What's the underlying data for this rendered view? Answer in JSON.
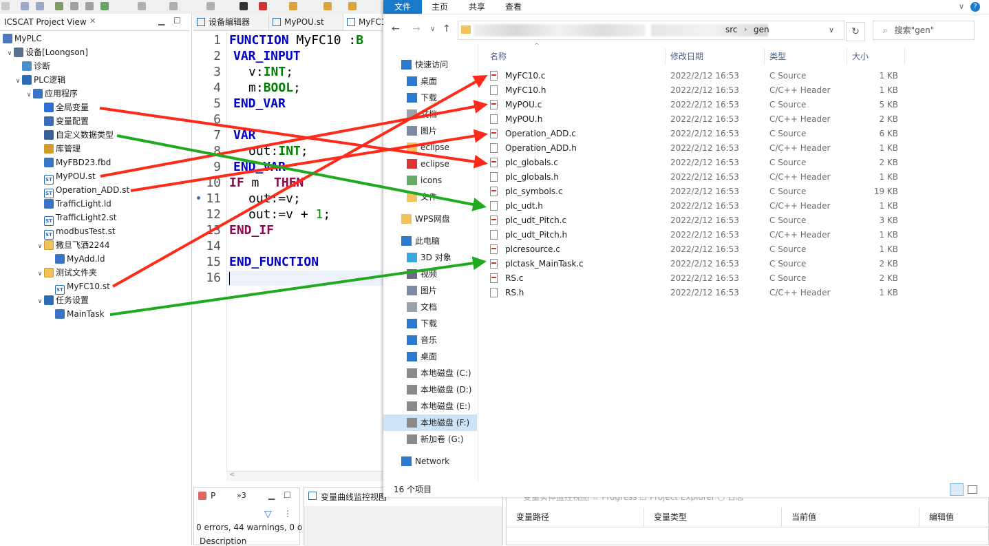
{
  "ide": {
    "project_view": {
      "title": "ICSCAT Project View",
      "tree": [
        {
          "label": "MyPLC",
          "icon": "project-icon"
        },
        {
          "label": "设备[Loongson]",
          "icon": "device-icon"
        },
        {
          "label": "诊断",
          "icon": "diagnose-icon"
        },
        {
          "label": "PLC逻辑",
          "icon": "gear-icon"
        },
        {
          "label": "应用程序",
          "icon": "application-icon"
        },
        {
          "label": "全局变量",
          "icon": "globe-icon"
        },
        {
          "label": "变量配置",
          "icon": "config-icon"
        },
        {
          "label": "自定义数据类型",
          "icon": "datatype-icon"
        },
        {
          "label": "库管理",
          "icon": "library-icon"
        },
        {
          "label": "MyFBD23.fbd",
          "icon": "fbd-icon"
        },
        {
          "label": "MyPOU.st",
          "icon": "st-icon"
        },
        {
          "label": "Operation_ADD.st",
          "icon": "st-icon"
        },
        {
          "label": "TrafficLight.ld",
          "icon": "ld-icon"
        },
        {
          "label": "TrafficLight2.st",
          "icon": "st-icon"
        },
        {
          "label": "modbusTest.st",
          "icon": "st-icon"
        },
        {
          "label": "撒旦飞洒2244",
          "icon": "folder-icon"
        },
        {
          "label": "MyAdd.ld",
          "icon": "ld-icon"
        },
        {
          "label": "测试文件夹",
          "icon": "folder-icon"
        },
        {
          "label": "MyFC10.st",
          "icon": "st-icon"
        },
        {
          "label": "任务设置",
          "icon": "task-settings-icon"
        },
        {
          "label": "MainTask",
          "icon": "task-icon"
        }
      ]
    },
    "editor_tabs": [
      "设备编辑器",
      "MyPOU.st",
      "MyFC1"
    ],
    "code": {
      "lines": [
        "1",
        "2",
        "3",
        "4",
        "5",
        "6",
        "7",
        "8",
        "9",
        "10",
        "11",
        "12",
        "13",
        "14",
        "15",
        "16"
      ],
      "l1_kw": "FUNCTION",
      "l1_name": " MyFC10 :",
      "l1_type": "B",
      "l2": "VAR_INPUT",
      "l3_a": "v:",
      "l3_t": "INT",
      "l3_b": ";",
      "l4_a": "m:",
      "l4_t": "BOOL",
      "l4_b": ";",
      "l5": "END_VAR",
      "l7": "VAR",
      "l8_a": "out:",
      "l8_t": "INT",
      "l8_b": ";",
      "l9": "END_VAR",
      "l10_kw": "IF",
      "l10_m": " m  ",
      "l10_then": "THEN",
      "l11": "out:=v;",
      "l12_a": "out:=v + ",
      "l12_n": "1",
      "l12_b": ";",
      "l13": "END_IF",
      "l15": "END_FUNCTION"
    },
    "problems": {
      "tab1": "P",
      "tab2": "»3",
      "summary": "0 errors, 44 warnings, 0 o",
      "col": "Description"
    },
    "monitor_tab": "变量曲线监控视图",
    "var_table": {
      "tabs_faded": "变量实体监控视图  ☆  Progress  ☐ Project Explorer  ○ 日志",
      "headers": [
        "变量路径",
        "变量类型",
        "当前值",
        "编辑值"
      ]
    }
  },
  "explorer": {
    "ribbon": [
      "文件",
      "主页",
      "共享",
      "查看"
    ],
    "breadcrumb": [
      "src",
      "gen"
    ],
    "search_placeholder": "搜索\"gen\"",
    "nav": [
      {
        "label": "快速访问",
        "icon": "star-icon"
      },
      {
        "label": "桌面",
        "icon": "desktop-icon"
      },
      {
        "label": "下载",
        "icon": "download-icon"
      },
      {
        "label": "文档",
        "icon": "document-icon"
      },
      {
        "label": "图片",
        "icon": "picture-icon"
      },
      {
        "label": "eclipse",
        "icon": "folder-icon"
      },
      {
        "label": "eclipse",
        "icon": "eclipse-icon"
      },
      {
        "label": "icons",
        "icon": "icons-icon"
      },
      {
        "label": "文件",
        "icon": "folder-icon"
      },
      {
        "label": "WPS网盘",
        "icon": "cloud-folder-icon"
      },
      {
        "label": "此电脑",
        "icon": "computer-icon"
      },
      {
        "label": "3D 对象",
        "icon": "3d-icon"
      },
      {
        "label": "视频",
        "icon": "video-icon"
      },
      {
        "label": "图片",
        "icon": "picture-icon"
      },
      {
        "label": "文档",
        "icon": "document-icon"
      },
      {
        "label": "下载",
        "icon": "download-icon"
      },
      {
        "label": "音乐",
        "icon": "music-icon"
      },
      {
        "label": "桌面",
        "icon": "desktop-icon"
      },
      {
        "label": "本地磁盘 (C:)",
        "icon": "drive-icon"
      },
      {
        "label": "本地磁盘 (D:)",
        "icon": "drive-icon"
      },
      {
        "label": "本地磁盘 (E:)",
        "icon": "drive-icon"
      },
      {
        "label": "本地磁盘 (F:)",
        "icon": "drive-icon"
      },
      {
        "label": "新加卷 (G:)",
        "icon": "drive-icon"
      },
      {
        "label": "Network",
        "icon": "network-icon"
      }
    ],
    "columns": [
      "名称",
      "修改日期",
      "类型",
      "大小"
    ],
    "files": [
      {
        "name": "MyFC10.c",
        "date": "2022/2/12 16:53",
        "type": "C Source",
        "size": "1 KB"
      },
      {
        "name": "MyFC10.h",
        "date": "2022/2/12 16:53",
        "type": "C/C++ Header",
        "size": "1 KB"
      },
      {
        "name": "MyPOU.c",
        "date": "2022/2/12 16:53",
        "type": "C Source",
        "size": "5 KB"
      },
      {
        "name": "MyPOU.h",
        "date": "2022/2/12 16:53",
        "type": "C/C++ Header",
        "size": "2 KB"
      },
      {
        "name": "Operation_ADD.c",
        "date": "2022/2/12 16:53",
        "type": "C Source",
        "size": "6 KB"
      },
      {
        "name": "Operation_ADD.h",
        "date": "2022/2/12 16:53",
        "type": "C/C++ Header",
        "size": "1 KB"
      },
      {
        "name": "plc_globals.c",
        "date": "2022/2/12 16:53",
        "type": "C Source",
        "size": "2 KB"
      },
      {
        "name": "plc_globals.h",
        "date": "2022/2/12 16:53",
        "type": "C/C++ Header",
        "size": "1 KB"
      },
      {
        "name": "plc_symbols.c",
        "date": "2022/2/12 16:53",
        "type": "C Source",
        "size": "19 KB"
      },
      {
        "name": "plc_udt.h",
        "date": "2022/2/12 16:53",
        "type": "C/C++ Header",
        "size": "1 KB"
      },
      {
        "name": "plc_udt_Pitch.c",
        "date": "2022/2/12 16:53",
        "type": "C Source",
        "size": "3 KB"
      },
      {
        "name": "plc_udt_Pitch.h",
        "date": "2022/2/12 16:53",
        "type": "C/C++ Header",
        "size": "1 KB"
      },
      {
        "name": "plcresource.c",
        "date": "2022/2/12 16:53",
        "type": "C Source",
        "size": "1 KB"
      },
      {
        "name": "plctask_MainTask.c",
        "date": "2022/2/12 16:53",
        "type": "C Source",
        "size": "2 KB"
      },
      {
        "name": "RS.c",
        "date": "2022/2/12 16:53",
        "type": "C Source",
        "size": "2 KB"
      },
      {
        "name": "RS.h",
        "date": "2022/2/12 16:53",
        "type": "C/C++ Header",
        "size": "1 KB"
      }
    ],
    "status": "16 个项目"
  },
  "annotation_colors": {
    "red": "#ff2a1a",
    "green": "#1faa1f"
  }
}
